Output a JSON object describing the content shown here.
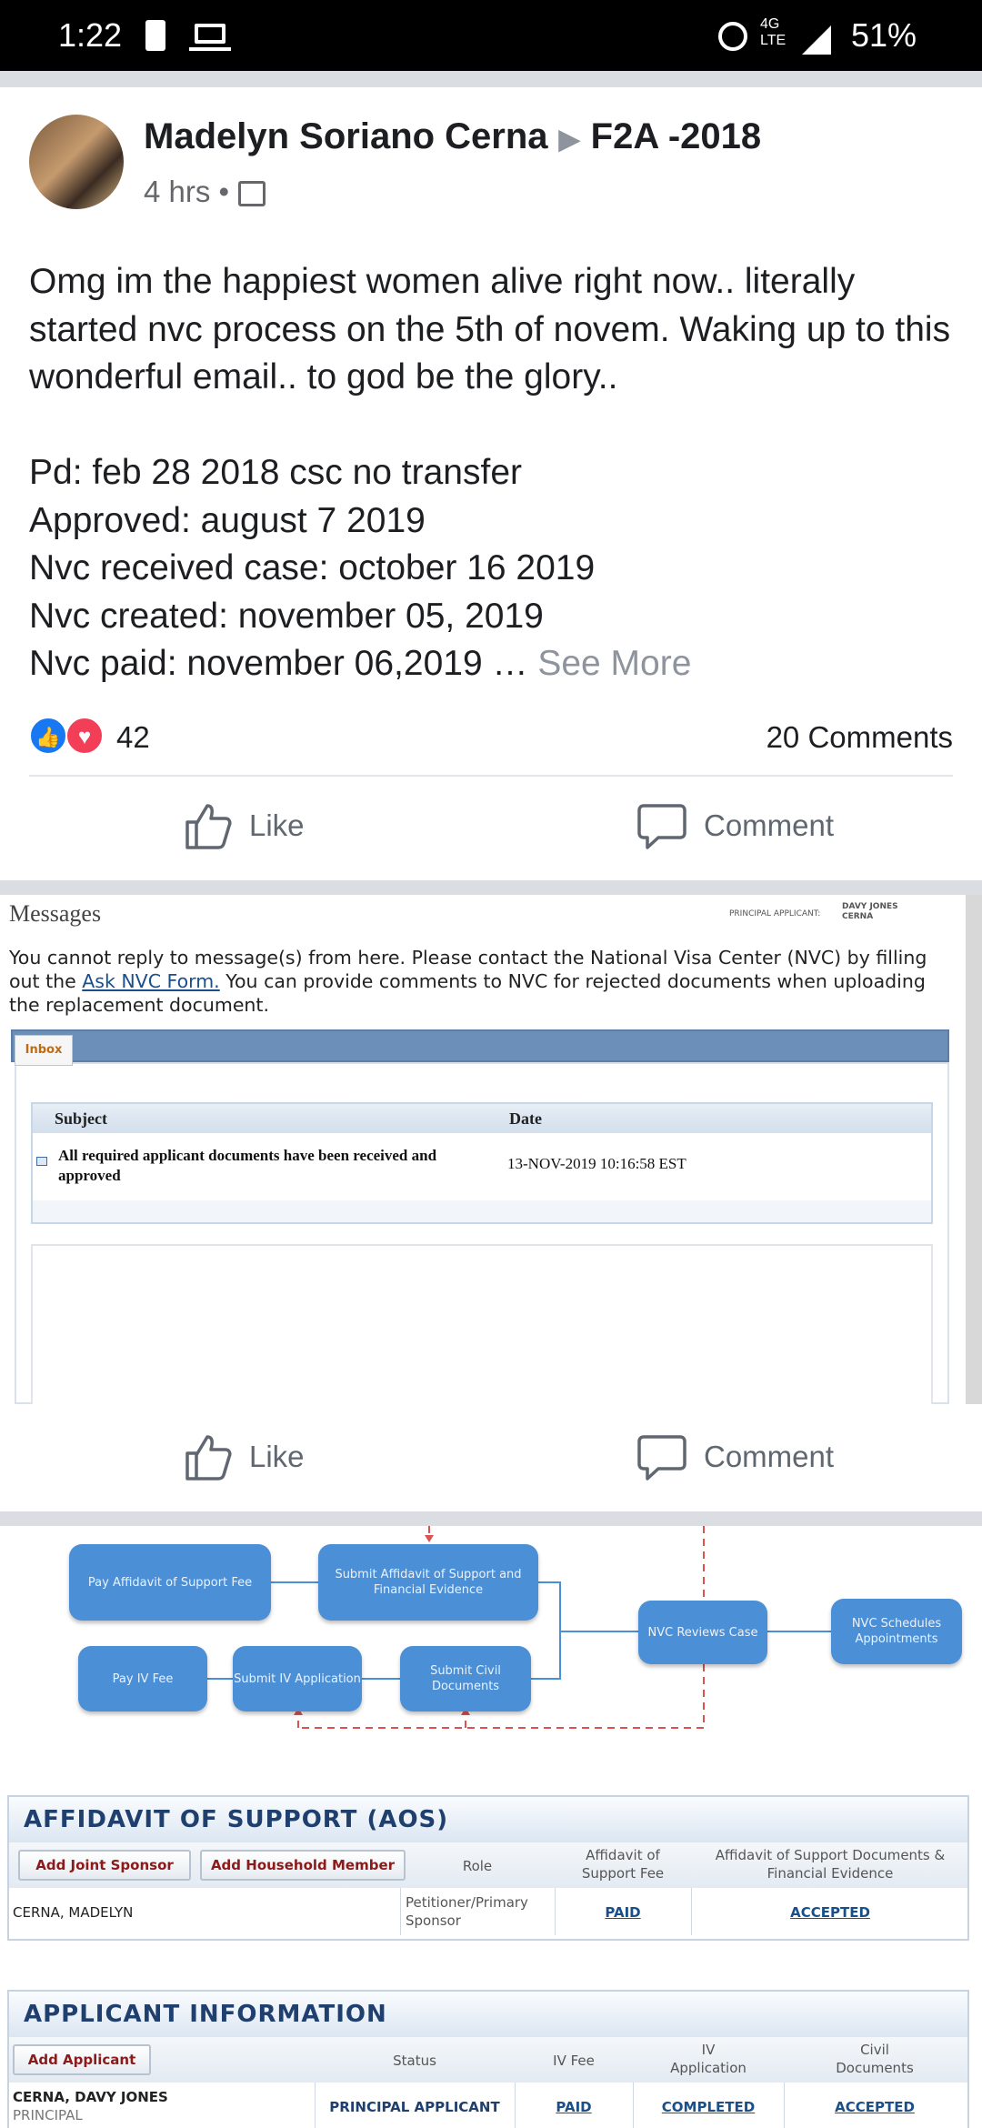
{
  "status_bar": {
    "time": "1:22",
    "network_top": "4G",
    "network_bottom": "LTE",
    "battery": "51%"
  },
  "post": {
    "author": "Madelyn Soriano Cerna",
    "group": "F2A -2018",
    "time": "4 hrs",
    "text": "Omg im the happiest women alive right now.. literally started nvc process on the 5th of novem. Waking up to this wonderful email.. to god be the glory..\n\nPd: feb 28 2018 csc no transfer\nApproved: august 7 2019\nNvc received case: october 16 2019\nNvc created: november 05, 2019\nNvc paid: november 06,2019 … ",
    "see_more": "See More",
    "reaction_count": "42",
    "comments": "20 Comments",
    "like": "Like",
    "comment": "Comment"
  },
  "image1": {
    "title": "Messages",
    "principal_label": "PRINCIPAL APPLICANT:",
    "principal_name_1": "DAVY JONES",
    "principal_name_2": "CERNA",
    "note_before": "You cannot reply to message(s) from here.  Please contact the National Visa Center (NVC) by filling out the ",
    "note_link": "Ask NVC Form.",
    "note_after": "  You can provide comments to NVC for rejected documents when uploading the replacement document.",
    "tab": "Inbox",
    "col_subject": "Subject",
    "col_date": "Date",
    "row_subject": "All required applicant documents have been received and approved",
    "row_date": "13-NOV-2019 10:16:58 EST"
  },
  "actions2": {
    "like": "Like",
    "comment": "Comment"
  },
  "image2": {
    "flow": {
      "pay_aos_fee": "Pay Affidavit of Support Fee",
      "submit_aos": "Submit Affidavit of Support and Financial Evidence",
      "pay_iv_fee": "Pay IV Fee",
      "submit_iv": "Submit IV Application",
      "submit_civil": "Submit Civil Documents",
      "nvc_reviews": "NVC Reviews Case",
      "nvc_schedules": "NVC Schedules Appointments"
    },
    "aos": {
      "title": "AFFIDAVIT OF SUPPORT (AOS)",
      "btn_joint": "Add Joint Sponsor",
      "btn_household": "Add Household Member",
      "col_role": "Role",
      "col_fee_1": "Affidavit of",
      "col_fee_2": "Support Fee",
      "col_docs_1": "Affidavit of Support Documents &",
      "col_docs_2": "Financial Evidence",
      "name": "CERNA, MADELYN",
      "role_1": "Petitioner/Primary",
      "role_2": "Sponsor",
      "fee": "PAID",
      "docs": "ACCEPTED"
    },
    "applicant": {
      "title": "APPLICANT INFORMATION",
      "btn_add": "Add Applicant",
      "col_status": "Status",
      "col_iv_fee": "IV Fee",
      "col_iv_app_1": "IV",
      "col_iv_app_2": "Application",
      "col_civil_1": "Civil",
      "col_civil_2": "Documents",
      "name": "CERNA, DAVY JONES",
      "sub": "PRINCIPAL",
      "status": "PRINCIPAL APPLICANT",
      "iv_fee": "PAID",
      "iv_app": "COMPLETED",
      "civil": "ACCEPTED"
    }
  }
}
